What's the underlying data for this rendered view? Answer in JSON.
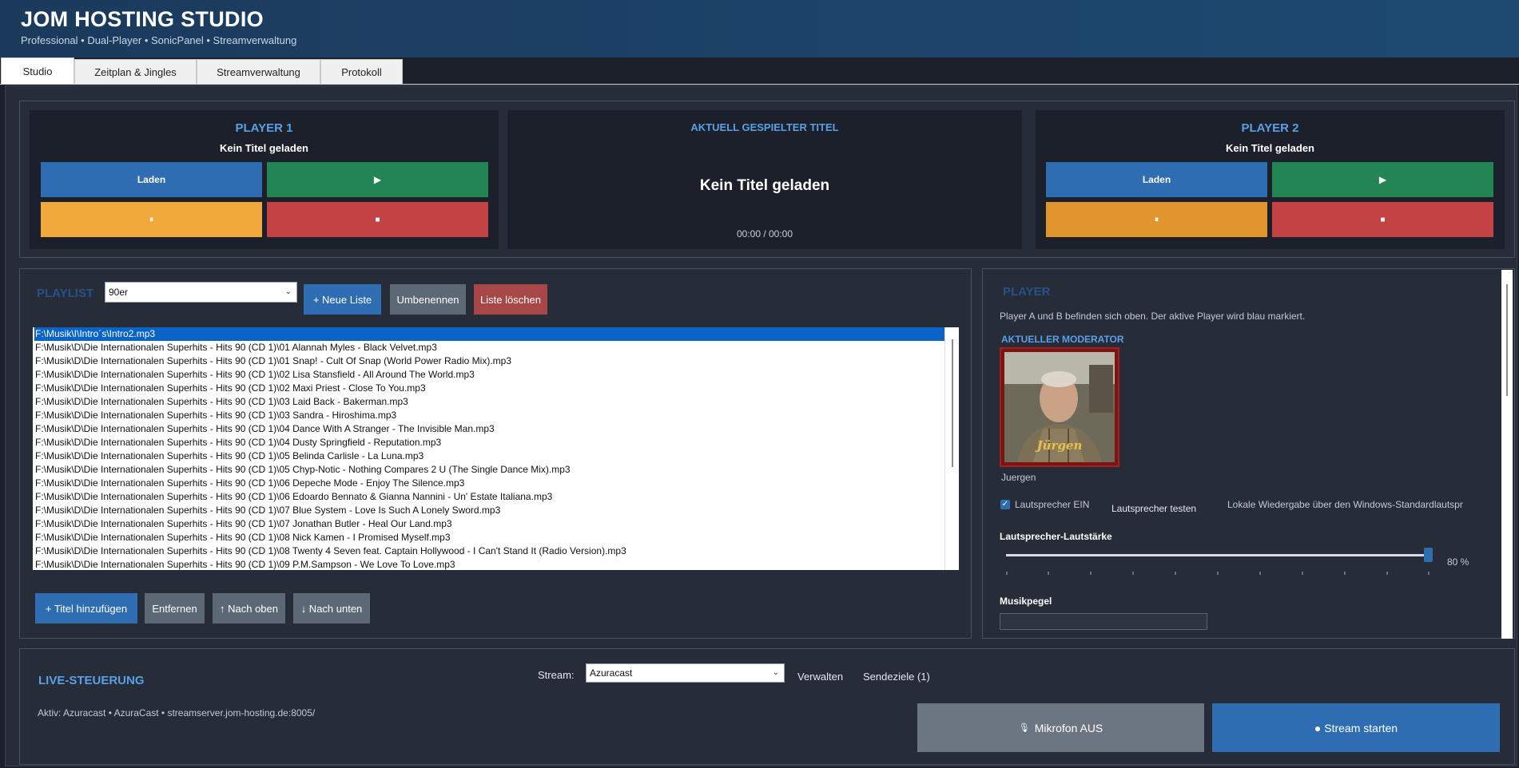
{
  "app": {
    "title": "JOM HOSTING STUDIO",
    "subtitle": "Professional  •  Dual-Player • SonicPanel • Streamverwaltung"
  },
  "tabs": [
    "Studio",
    "Zeitplan & Jingles",
    "Streamverwaltung",
    "Protokoll"
  ],
  "player1": {
    "title": "PLAYER 1",
    "track": "Kein Titel geladen",
    "load_label": "Laden",
    "play_icon": "▶",
    "pause_icon": "⏸",
    "stop_icon": "■"
  },
  "now_playing": {
    "title": "AKTUELL GESPIELTER TITEL",
    "track": "Kein Titel geladen",
    "time": "00:00 / 00:00"
  },
  "player2": {
    "title": "PLAYER 2",
    "track": "Kein Titel geladen",
    "load_label": "Laden",
    "play_icon": "▶",
    "pause_icon": "⏸",
    "stop_icon": "■"
  },
  "playlist": {
    "title": "PLAYLIST",
    "selected_list": "90er",
    "new_list_label": "+  Neue Liste",
    "rename_label": "Umbenennen",
    "delete_label": "Liste löschen",
    "items": [
      "F:\\Musik\\I\\Intro´s\\Intro2.mp3",
      "F:\\Musik\\D\\Die Internationalen Superhits - Hits 90 (CD 1)\\01 Alannah Myles - Black Velvet.mp3",
      "F:\\Musik\\D\\Die Internationalen Superhits - Hits 90 (CD 1)\\01 Snap! - Cult Of Snap (World Power Radio Mix).mp3",
      "F:\\Musik\\D\\Die Internationalen Superhits - Hits 90 (CD 1)\\02 Lisa Stansfield - All Around The World.mp3",
      "F:\\Musik\\D\\Die Internationalen Superhits - Hits 90 (CD 1)\\02 Maxi Priest - Close To You.mp3",
      "F:\\Musik\\D\\Die Internationalen Superhits - Hits 90 (CD 1)\\03 Laid Back - Bakerman.mp3",
      "F:\\Musik\\D\\Die Internationalen Superhits - Hits 90 (CD 1)\\03 Sandra - Hiroshima.mp3",
      "F:\\Musik\\D\\Die Internationalen Superhits - Hits 90 (CD 1)\\04 Dance With A Stranger - The Invisible Man.mp3",
      "F:\\Musik\\D\\Die Internationalen Superhits - Hits 90 (CD 1)\\04 Dusty Springfield - Reputation.mp3",
      "F:\\Musik\\D\\Die Internationalen Superhits - Hits 90 (CD 1)\\05 Belinda Carlisle - La Luna.mp3",
      "F:\\Musik\\D\\Die Internationalen Superhits - Hits 90 (CD 1)\\05 Chyp-Notic - Nothing Compares 2 U (The Single Dance Mix).mp3",
      "F:\\Musik\\D\\Die Internationalen Superhits - Hits 90 (CD 1)\\06 Depeche Mode - Enjoy The Silence.mp3",
      "F:\\Musik\\D\\Die Internationalen Superhits - Hits 90 (CD 1)\\06 Edoardo Bennato & Gianna Nannini - Un' Estate Italiana.mp3",
      "F:\\Musik\\D\\Die Internationalen Superhits - Hits 90 (CD 1)\\07 Blue System - Love Is Such A Lonely Sword.mp3",
      "F:\\Musik\\D\\Die Internationalen Superhits - Hits 90 (CD 1)\\07 Jonathan Butler - Heal Our Land.mp3",
      "F:\\Musik\\D\\Die Internationalen Superhits - Hits 90 (CD 1)\\08 Nick Kamen - I Promised Myself.mp3",
      "F:\\Musik\\D\\Die Internationalen Superhits - Hits 90 (CD 1)\\08 Twenty 4 Seven feat. Captain Hollywood - I Can't Stand It (Radio Version).mp3",
      "F:\\Musik\\D\\Die Internationalen Superhits - Hits 90 (CD 1)\\09 P.M.Sampson - We Love To Love.mp3"
    ],
    "add_label": "+  Titel hinzufügen",
    "remove_label": "Entfernen",
    "up_label": "↑ Nach oben",
    "down_label": "↓ Nach unten"
  },
  "player_panel": {
    "title": "PLAYER",
    "info": "Player A und B befinden sich oben. Der aktive Player wird blau markiert.",
    "moderator_title": "AKTUELLER MODERATOR",
    "photo_caption": "Jürgen",
    "moderator_name": "Juergen",
    "speaker_label": "Lautsprecher EIN",
    "speaker_checked": true,
    "speaker_test_label": "Lautsprecher testen",
    "local_playback_text": "Lokale Wiedergabe über den Windows-Standardlautspr",
    "volume_label": "Lautsprecher-Lautstärke",
    "volume_value": 80,
    "volume_text": "80 %",
    "music_level_label": "Musikpegel"
  },
  "live": {
    "title": "LIVE-STEUERUNG",
    "stream_label": "Stream:",
    "stream_selected": "Azuracast",
    "manage_label": "Verwalten",
    "targets_label": "Sendeziele (1)",
    "active_info": "Aktiv: Azuracast  •  AzuraCast  •  streamserver.jom-hosting.de:8005/",
    "mic_label": "Mikrofon AUS",
    "mic_icon": "🎙",
    "start_label": "● Stream starten"
  },
  "colors": {
    "accent_blue": "#2f6db3",
    "play_green": "#238454",
    "pause_yellow": "#f0a83a",
    "stop_red": "#c34244",
    "header_title_blue": "#5aa0e6"
  }
}
